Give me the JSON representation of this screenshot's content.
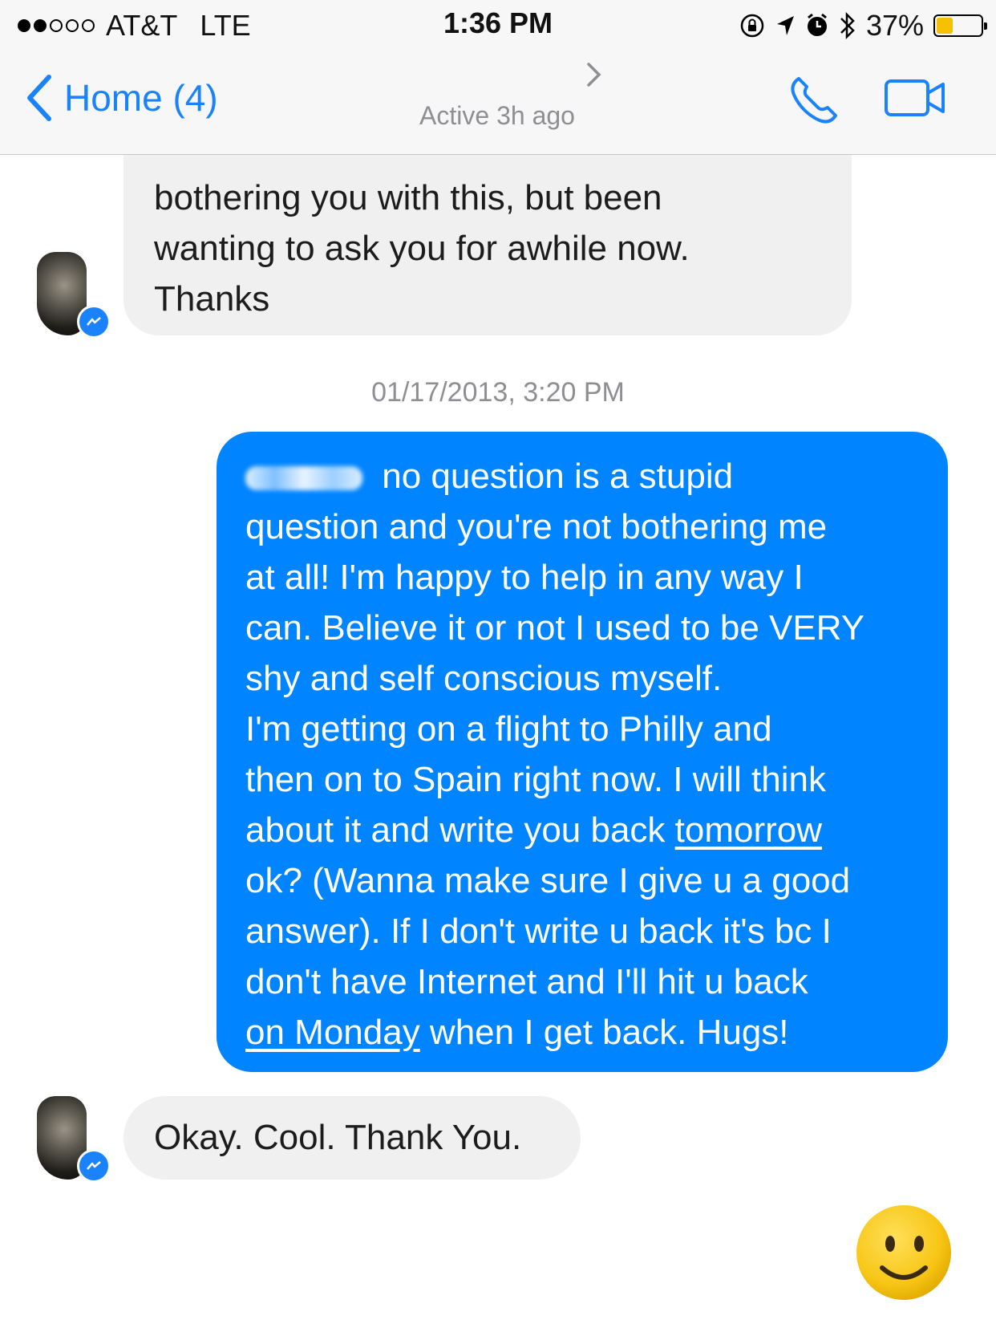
{
  "status_bar": {
    "carrier": "AT&T",
    "network": "LTE",
    "time": "1:36 PM",
    "battery": "37%",
    "battery_level": 0.37,
    "icons": [
      "orientation-lock-icon",
      "location-arrow-icon",
      "alarm-icon",
      "bluetooth-icon",
      "battery-icon"
    ]
  },
  "nav": {
    "back_label": "Home (4)",
    "active_status": "Active 3h ago",
    "accent_color": "#1a82fb"
  },
  "messages": [
    {
      "direction": "incoming",
      "lines": [
        "bothering you with this, but been",
        "wanting to ask you for awhile now.",
        "Thanks"
      ]
    },
    {
      "direction": "outgoing",
      "lines": [
        " no question is a stupid",
        "question and you're not bothering me",
        "at all! I'm happy to help in any way I",
        "can. Believe it or not I used to be VERY",
        "shy and self conscious myself.",
        "I'm getting on a flight to Philly and",
        "then on to Spain right now. I will think",
        "about it and write you back ",
        "tomorrow",
        "ok? (Wanna make sure I give u a good",
        "answer). If I don't write u back it's bc I",
        "don't have Internet and I'll hit u back",
        "on Monday",
        " when I get back. Hugs!"
      ],
      "color": "#0084ff"
    },
    {
      "direction": "incoming",
      "lines": [
        "Okay. Cool. Thank You."
      ]
    }
  ],
  "timestamp": "01/17/2013, 3:20 PM",
  "emoji": "smiley-face-icon"
}
